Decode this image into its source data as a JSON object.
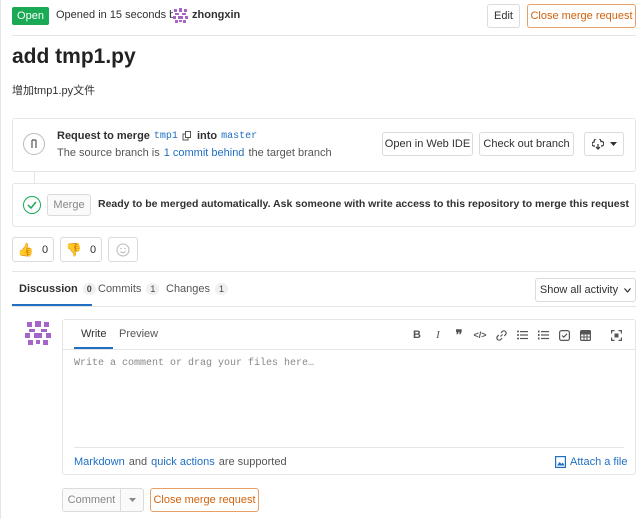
{
  "header": {
    "status_badge": "Open",
    "opened_text": "Opened in 15 seconds by",
    "author": "zhongxin",
    "edit_label": "Edit",
    "close_label": "Close merge request"
  },
  "title": "add tmp1.py",
  "description": "增加tmp1.py文件",
  "widget": {
    "request_prefix": "Request to merge",
    "source_branch": "tmp1",
    "into_text": "into",
    "target_branch": "master",
    "status_prefix": "The source branch is",
    "commits_behind": "1 commit behind",
    "status_suffix": "the target branch",
    "open_ide_label": "Open in Web IDE",
    "checkout_label": "Check out branch"
  },
  "merge": {
    "button_label": "Merge",
    "message": "Ready to be merged automatically. Ask someone with write access to this repository to merge this request"
  },
  "reactions": {
    "thumbs_up_count": "0",
    "thumbs_down_count": "0"
  },
  "tabs": [
    {
      "label": "Discussion",
      "count": "0"
    },
    {
      "label": "Commits",
      "count": "1"
    },
    {
      "label": "Changes",
      "count": "1"
    }
  ],
  "activity_filter": "Show all activity",
  "editor": {
    "write_tab": "Write",
    "preview_tab": "Preview",
    "placeholder": "Write a comment or drag your files here…",
    "markdown_link": "Markdown",
    "and_text": "and",
    "quick_actions_link": "quick actions",
    "supported_text": "are supported",
    "attach_label": "Attach a file"
  },
  "footer": {
    "comment_label": "Comment",
    "close_label": "Close merge request"
  },
  "colors": {
    "open_badge": "#1aaa55",
    "link": "#1f6fc3",
    "orange": "#d0620c",
    "success": "#1aaa55"
  }
}
